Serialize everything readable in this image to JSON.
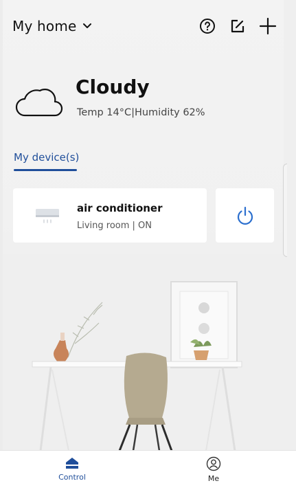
{
  "header": {
    "home_name": "My home"
  },
  "weather": {
    "condition": "Cloudy",
    "details": "Temp 14°C|Humidity 62%"
  },
  "tabs": [
    {
      "label": "My device(s)",
      "active": true
    }
  ],
  "devices": [
    {
      "name": "air conditioner",
      "status": "Living room | ON",
      "icon": "air-conditioner-icon",
      "power": "on"
    }
  ],
  "bottom_nav": {
    "items": [
      {
        "label": "Control",
        "icon": "home-icon",
        "active": true
      },
      {
        "label": "Me",
        "icon": "user-icon",
        "active": false
      }
    ]
  },
  "colors": {
    "accent": "#1f4e9a",
    "power": "#2b6fce"
  }
}
